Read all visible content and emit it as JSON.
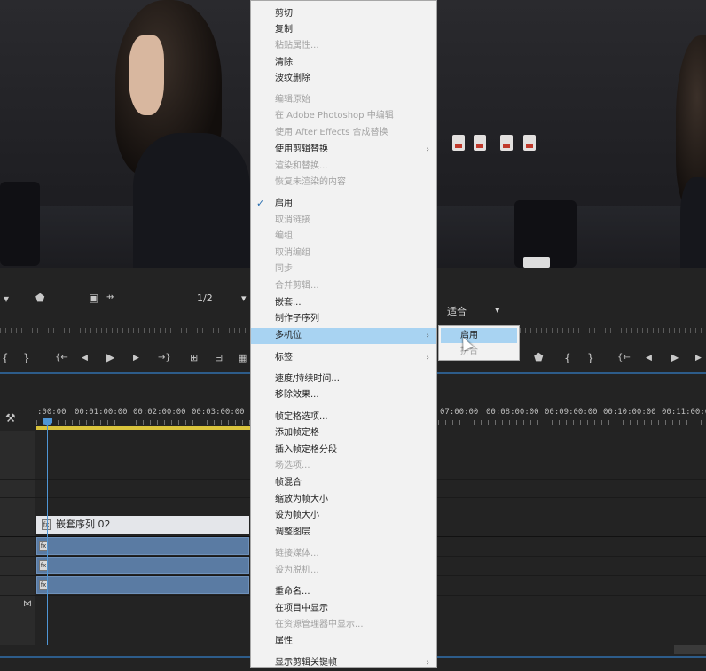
{
  "program_monitor": {
    "resolution": "1/2",
    "zoom": "适合"
  },
  "timeline": {
    "timecodes": [
      ":00:00",
      "00:01:00:00",
      "00:02:00:00",
      "00:03:00:00",
      "07:00:00",
      "00:08:00:00",
      "00:09:00:00",
      "00:10:00:00",
      "00:11:00:00"
    ],
    "nested_clip_label": "嵌套序列 02",
    "nested_clip_icon": "fx"
  },
  "context_menu": {
    "items": [
      {
        "label": "剪切",
        "enabled": true
      },
      {
        "label": "复制",
        "enabled": true
      },
      {
        "label": "粘贴属性...",
        "enabled": false
      },
      {
        "label": "清除",
        "enabled": true
      },
      {
        "label": "波纹删除",
        "enabled": true
      },
      {
        "label": "编辑原始",
        "enabled": false
      },
      {
        "label": "在 Adobe Photoshop 中编辑",
        "enabled": false
      },
      {
        "label": "使用 After Effects 合成替换",
        "enabled": false
      },
      {
        "label": "使用剪辑替换",
        "enabled": true,
        "submenu": true
      },
      {
        "label": "渲染和替换...",
        "enabled": false
      },
      {
        "label": "恢复未渲染的内容",
        "enabled": false
      },
      {
        "label": "启用",
        "enabled": true,
        "checked": true
      },
      {
        "label": "取消链接",
        "enabled": false
      },
      {
        "label": "编组",
        "enabled": false
      },
      {
        "label": "取消编组",
        "enabled": false
      },
      {
        "label": "同步",
        "enabled": false
      },
      {
        "label": "合并剪辑...",
        "enabled": false
      },
      {
        "label": "嵌套...",
        "enabled": true
      },
      {
        "label": "制作子序列",
        "enabled": true
      },
      {
        "label": "多机位",
        "enabled": true,
        "submenu": true,
        "highlighted": true
      },
      {
        "label": "标签",
        "enabled": true,
        "submenu": true
      },
      {
        "label": "速度/持续时间...",
        "enabled": true
      },
      {
        "label": "移除效果...",
        "enabled": true
      },
      {
        "label": "帧定格选项...",
        "enabled": true
      },
      {
        "label": "添加帧定格",
        "enabled": true
      },
      {
        "label": "插入帧定格分段",
        "enabled": true
      },
      {
        "label": "场选项...",
        "enabled": false
      },
      {
        "label": "帧混合",
        "enabled": true
      },
      {
        "label": "缩放为帧大小",
        "enabled": true
      },
      {
        "label": "设为帧大小",
        "enabled": true
      },
      {
        "label": "调整图层",
        "enabled": true
      },
      {
        "label": "链接媒体...",
        "enabled": false
      },
      {
        "label": "设为脱机...",
        "enabled": false
      },
      {
        "label": "重命名...",
        "enabled": true
      },
      {
        "label": "在项目中显示",
        "enabled": true
      },
      {
        "label": "在资源管理器中显示...",
        "enabled": false
      },
      {
        "label": "属性",
        "enabled": true
      },
      {
        "label": "显示剪辑关键帧",
        "enabled": true,
        "submenu": true
      }
    ],
    "checkmark": "✓",
    "submenu_arrow": "›"
  },
  "submenu": {
    "items": [
      {
        "label": "启用",
        "enabled": true,
        "highlighted": true
      },
      {
        "label": "拼合",
        "enabled": false
      }
    ]
  },
  "icons": {
    "wrench": "🔧",
    "play": "▶",
    "step_back": "◀",
    "step_fwd": "▶"
  }
}
